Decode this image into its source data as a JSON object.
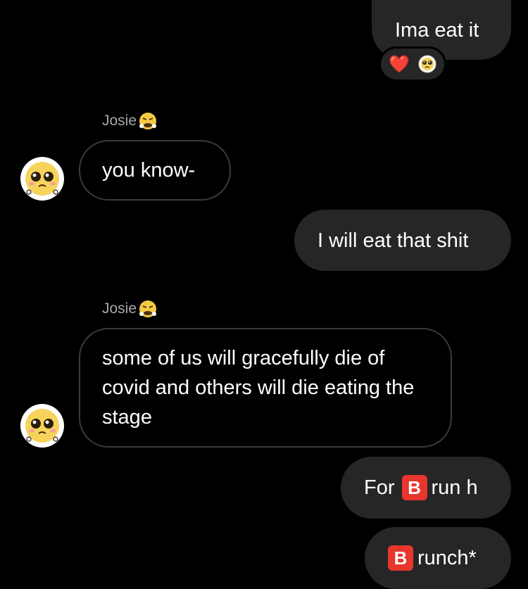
{
  "messages": [
    {
      "text": "Ima eat it"
    },
    {
      "text": "you know-"
    },
    {
      "text": "I will eat that shit"
    },
    {
      "text": "some of us will gracefully die of covid and others will die eating the stage"
    },
    {
      "prefix": "For",
      "b": "B",
      "suffix": "run h"
    },
    {
      "b": "B",
      "suffix": "runch*"
    }
  ],
  "sender": {
    "name": "Josie"
  },
  "reactions": {
    "heart": "❤️"
  },
  "icons": {
    "angry": "huffing-face",
    "avatar": "pleading-face"
  }
}
